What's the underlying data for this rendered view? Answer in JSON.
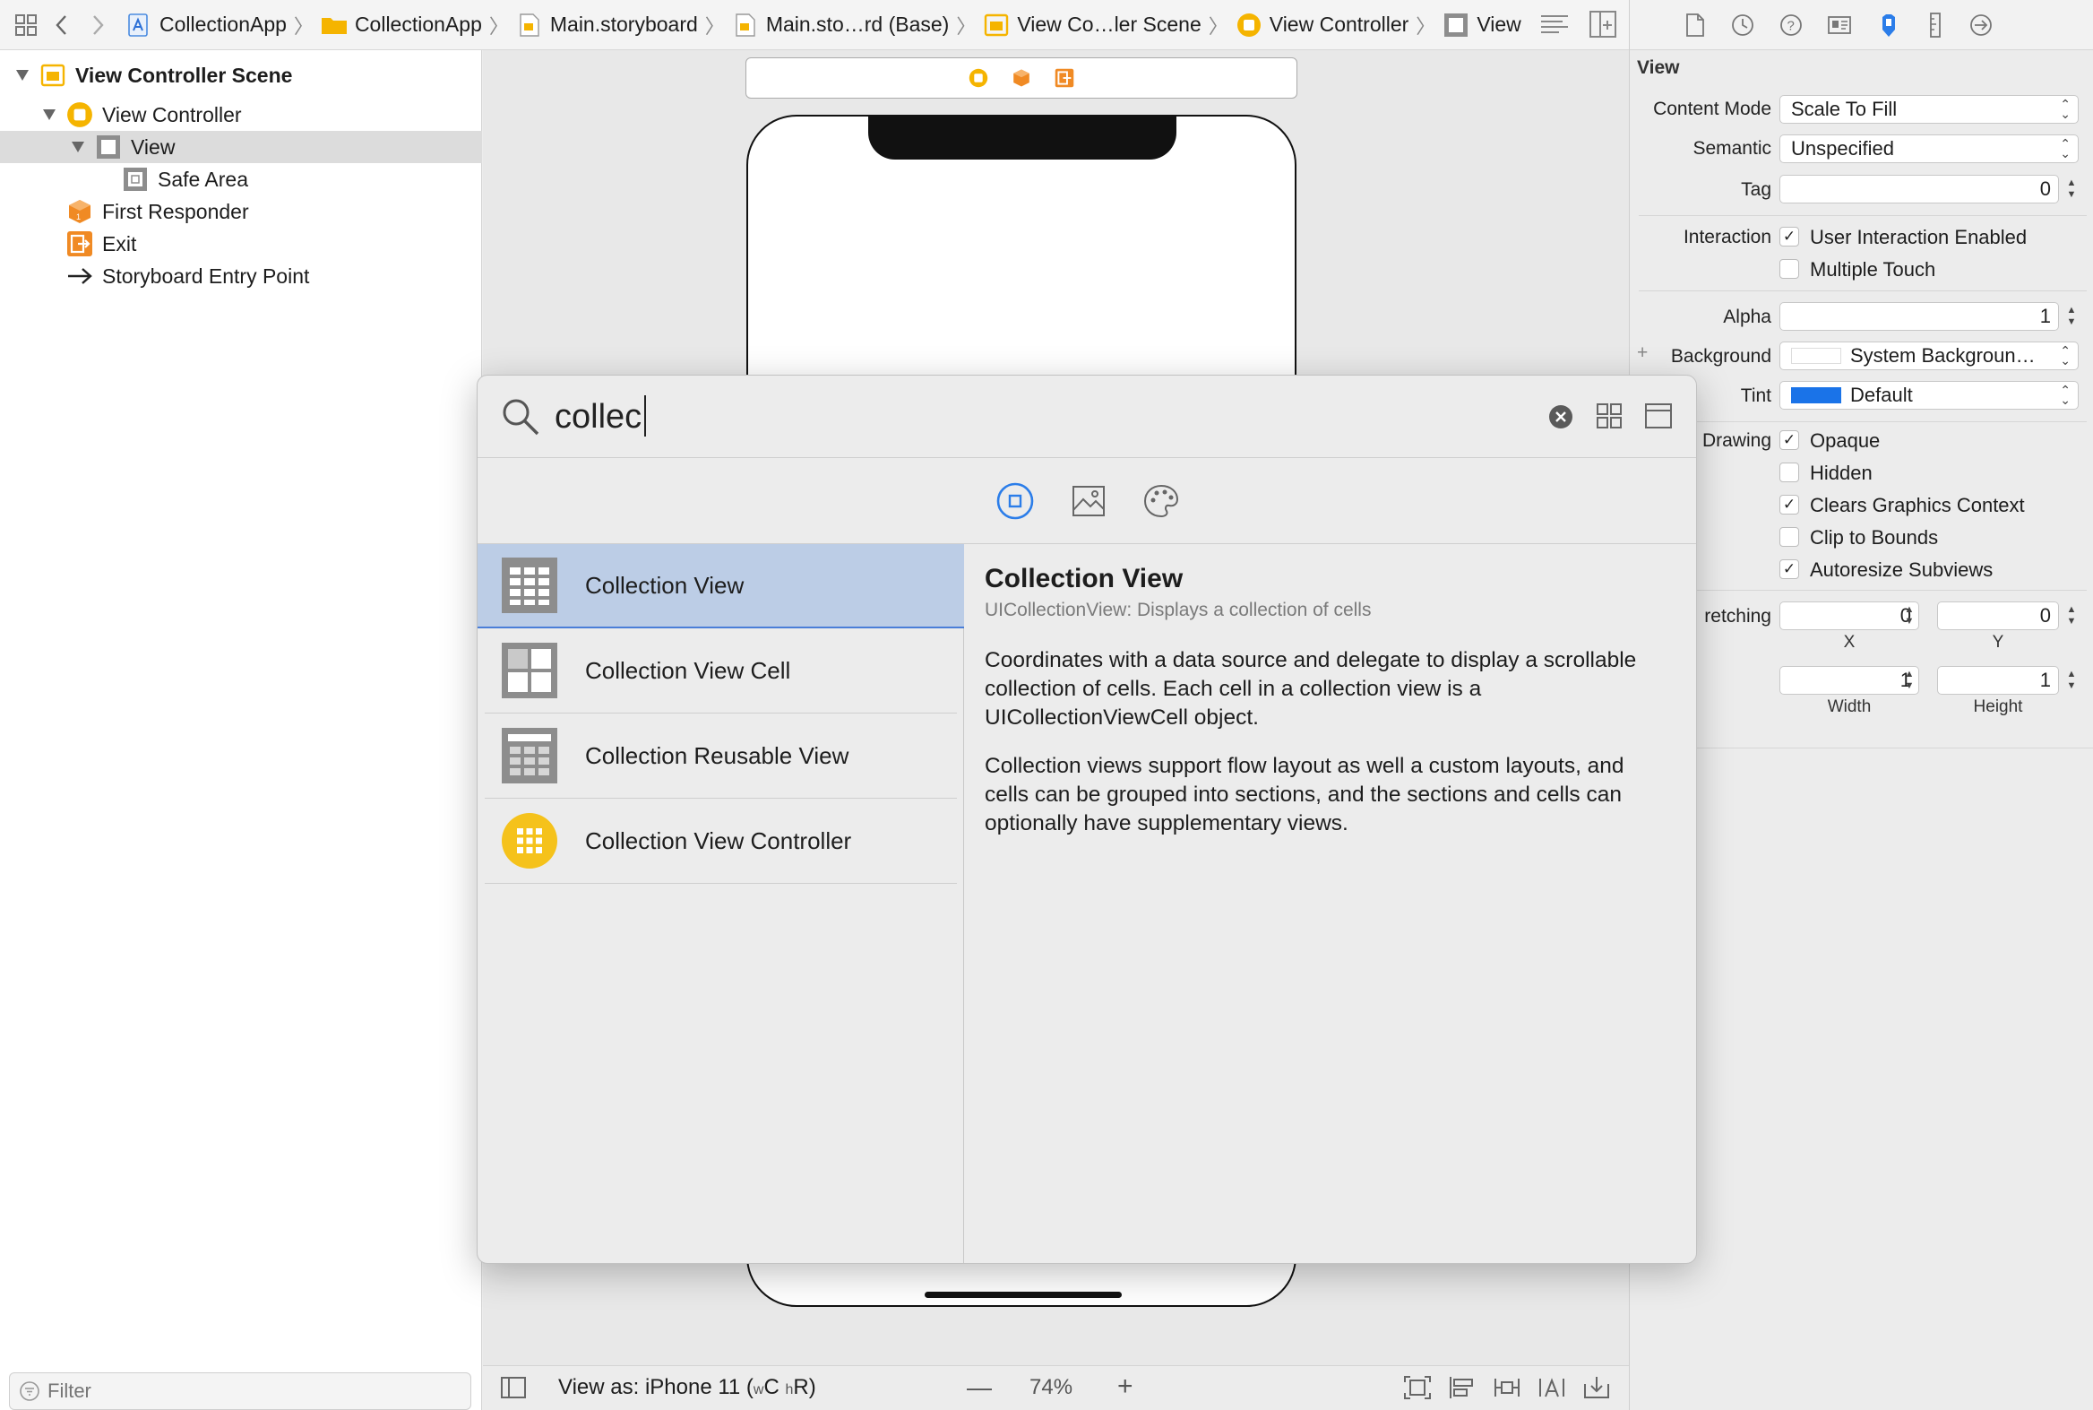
{
  "breadcrumb": [
    {
      "label": "CollectionApp",
      "icon": "xcode-project-icon"
    },
    {
      "label": "CollectionApp",
      "icon": "folder-icon"
    },
    {
      "label": "Main.storyboard",
      "icon": "storyboard-file-icon"
    },
    {
      "label": "Main.sto…rd (Base)",
      "icon": "storyboard-file-icon"
    },
    {
      "label": "View Co…ler Scene",
      "icon": "scene-icon"
    },
    {
      "label": "View Controller",
      "icon": "view-controller-icon"
    },
    {
      "label": "View",
      "icon": "view-icon"
    }
  ],
  "navigator": {
    "items": [
      {
        "label": "View Controller Scene",
        "icon": "scene-icon"
      },
      {
        "label": "View Controller",
        "icon": "view-controller-icon"
      },
      {
        "label": "View",
        "icon": "view-icon"
      },
      {
        "label": "Safe Area",
        "icon": "safe-area-icon"
      },
      {
        "label": "First Responder",
        "icon": "first-responder-icon"
      },
      {
        "label": "Exit",
        "icon": "exit-icon"
      },
      {
        "label": "Storyboard Entry Point",
        "icon": "arrow-right-icon"
      }
    ],
    "filter_placeholder": "Filter"
  },
  "canvas": {
    "view_as_prefix": "View as: iPhone 11 (",
    "size_w": "w",
    "size_w_val": "C",
    "size_h": "h",
    "size_h_val": "R)",
    "zoom_minus": "—",
    "zoom": "74%",
    "zoom_plus": "+"
  },
  "inspector": {
    "title": "View",
    "content_mode_label": "Content Mode",
    "content_mode": "Scale To Fill",
    "semantic_label": "Semantic",
    "semantic": "Unspecified",
    "tag_label": "Tag",
    "tag": "0",
    "interaction_label": "Interaction",
    "user_interaction": "User Interaction Enabled",
    "multiple_touch": "Multiple Touch",
    "alpha_label": "Alpha",
    "alpha": "1",
    "background_label": "Background",
    "background": "System Backgroun…",
    "plus": "+",
    "tint_label": "Tint",
    "tint": "Default",
    "tint_color": "#1a73e8",
    "drawing_label": "Drawing",
    "opaque": "Opaque",
    "hidden": "Hidden",
    "clears_graphics": "Clears Graphics Context",
    "clip_to_bounds": "Clip to Bounds",
    "autoresize": "Autoresize Subviews",
    "stretching_label": "retching",
    "stretch_x": "0",
    "stretch_y": "0",
    "stretch_w": "1",
    "stretch_h": "1",
    "x_label": "X",
    "y_label": "Y",
    "width_label": "Width",
    "height_label": "Height",
    "check_mark": "✓"
  },
  "library": {
    "query": "collec",
    "items": [
      {
        "label": "Collection View",
        "icon": "collection-view-icon"
      },
      {
        "label": "Collection View Cell",
        "icon": "collection-view-cell-icon"
      },
      {
        "label": "Collection Reusable View",
        "icon": "collection-reusable-view-icon"
      },
      {
        "label": "Collection View Controller",
        "icon": "collection-view-controller-icon"
      }
    ],
    "detail": {
      "title": "Collection View",
      "class": "UICollectionView: Displays a collection of cells",
      "p1": "Coordinates with a data source and delegate to display a scrollable collection of cells. Each cell in a collection view is a UICollectionViewCell object.",
      "p2": "Collection views support flow layout as well a custom layouts, and cells can be grouped into sections, and the sections and cells can optionally have supplementary views."
    }
  },
  "colors": {
    "accent": "#2b7de9",
    "storyboard_yellow": "#f5b800",
    "storyboard_orange": "#f08a24",
    "selection": "#bccde6"
  }
}
